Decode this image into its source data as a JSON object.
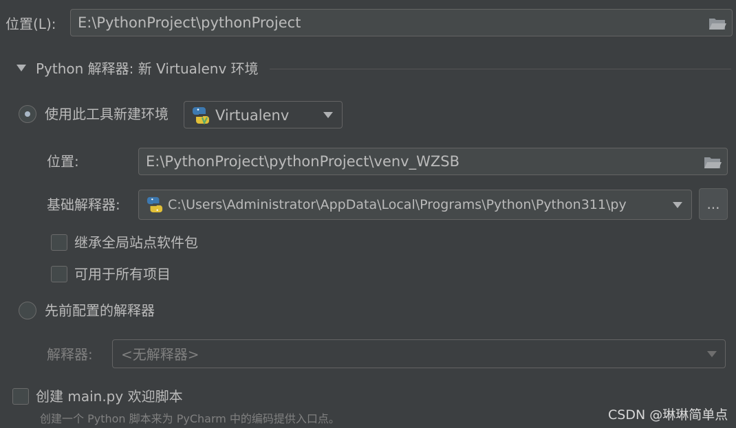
{
  "project_location": {
    "label": "位置(L):",
    "value": "E:\\PythonProject\\pythonProject"
  },
  "interpreter_section": {
    "title": "Python 解释器: 新 Virtualenv 环境"
  },
  "new_env": {
    "radio_label": "使用此工具新建环境",
    "tool_selected": "Virtualenv",
    "location_label": "位置:",
    "location_value": "E:\\PythonProject\\pythonProject\\venv_WZSB",
    "base_interpreter_label": "基础解释器:",
    "base_interpreter_value": "C:\\Users\\Administrator\\AppData\\Local\\Programs\\Python\\Python311\\py",
    "browse_button": "...",
    "inherit_packages_label": "继承全局站点软件包",
    "available_all_label": "可用于所有项目"
  },
  "previous_env": {
    "radio_label": "先前配置的解释器",
    "interpreter_label": "解释器:",
    "interpreter_value": "<无解释器>"
  },
  "welcome_script": {
    "checkbox_label": "创建 main.py 欢迎脚本",
    "hint": "创建一个 Python 脚本来为 PyCharm 中的编码提供入口点。"
  },
  "watermark": "CSDN @琳琳简单点",
  "colors": {
    "background": "#3c3f41",
    "field_background": "#45494a",
    "text": "#bbbbbb",
    "disabled_text": "#808080"
  },
  "icons": [
    "folder-icon",
    "python-icon",
    "virtualenv-icon",
    "chevron-down-icon"
  ]
}
